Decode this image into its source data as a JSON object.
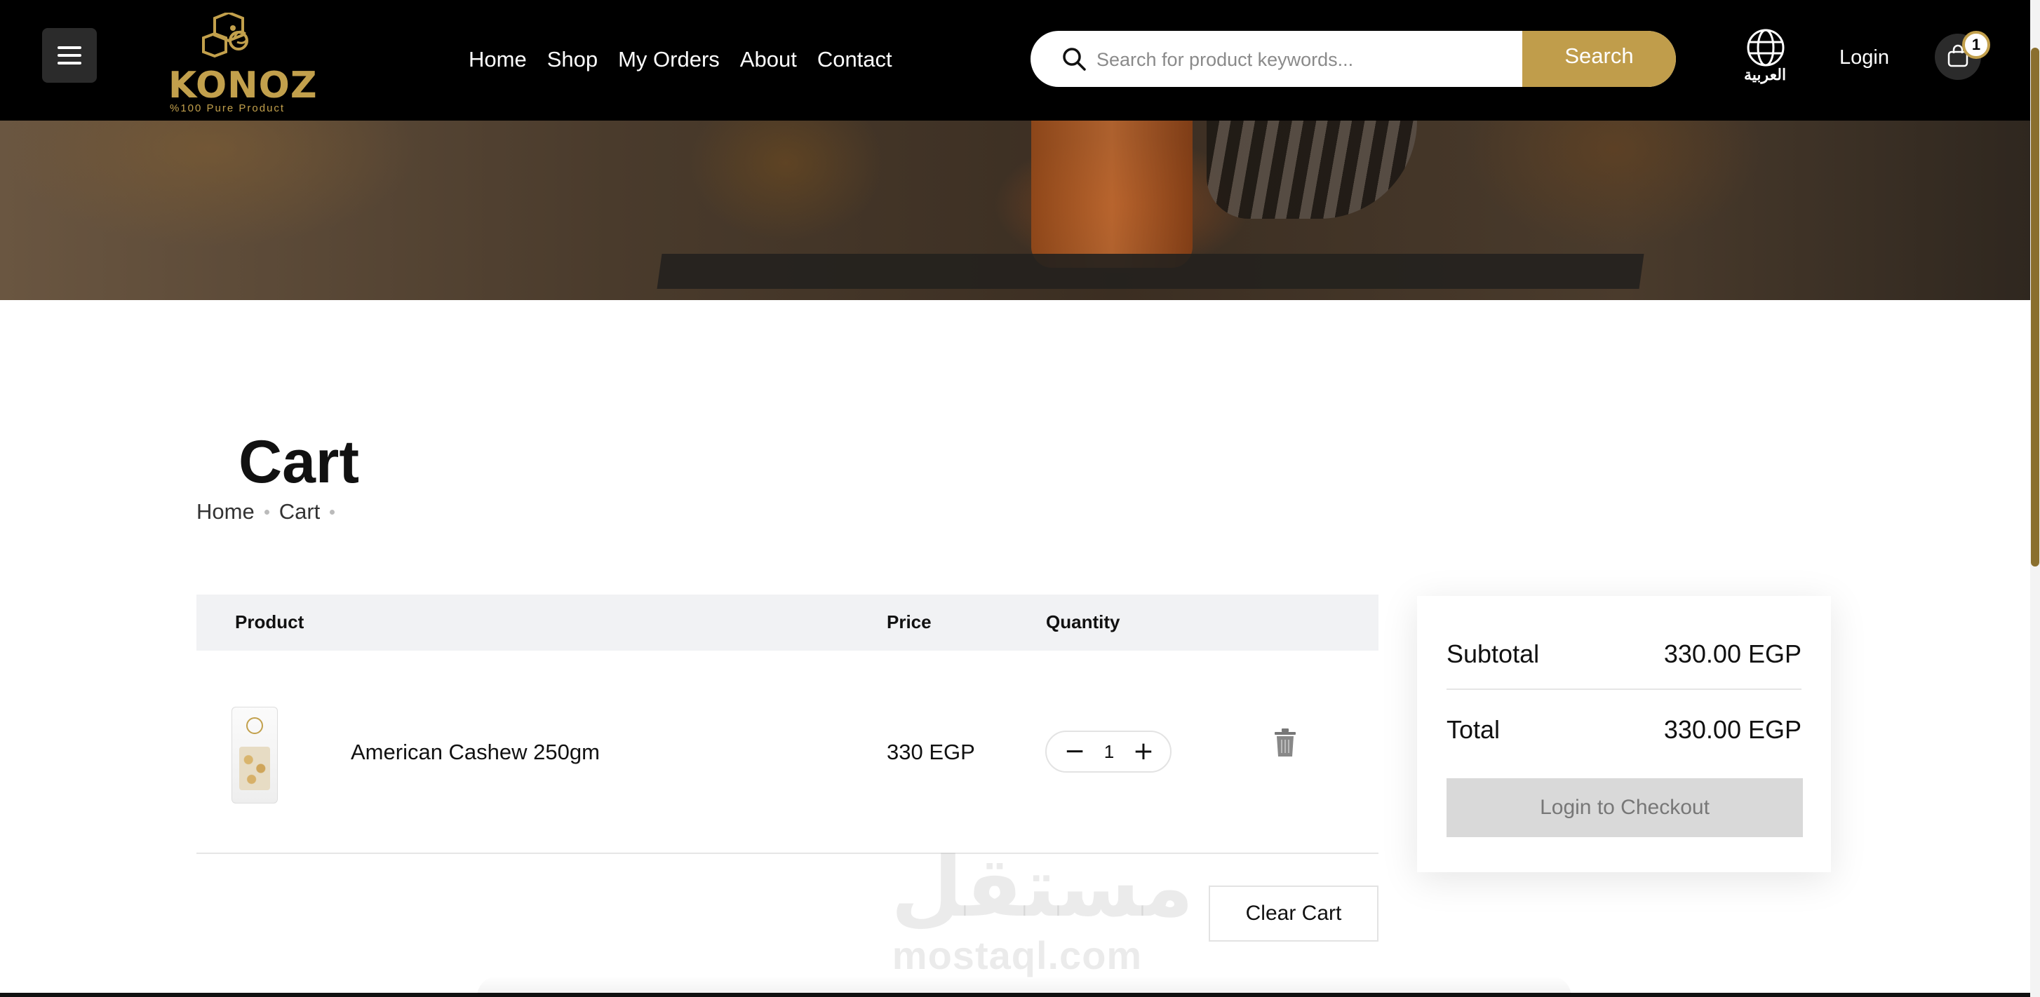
{
  "header": {
    "logo": {
      "word": "KONOZ",
      "tagline": "%100 Pure Product"
    },
    "nav": [
      "Home",
      "Shop",
      "My Orders",
      "About",
      "Contact"
    ],
    "search": {
      "placeholder": "Search for product keywords...",
      "button": "Search"
    },
    "language_label": "العربية",
    "login": "Login",
    "cart_count": "1",
    "icons": {
      "menu": "hamburger-icon",
      "search": "search-icon",
      "language": "globe-icon",
      "cart": "shopping-bag-icon"
    }
  },
  "page": {
    "title": "Cart",
    "breadcrumb": [
      "Home",
      "Cart"
    ]
  },
  "cart_table": {
    "headers": {
      "product": "Product",
      "price": "Price",
      "quantity": "Quantity"
    },
    "rows": [
      {
        "name": "American Cashew 250gm",
        "price": "330 EGP",
        "quantity": "1"
      }
    ],
    "clear_button": "Clear Cart",
    "qty_minus": "−",
    "qty_plus": "+"
  },
  "summary": {
    "subtotal_label": "Subtotal",
    "subtotal_value": "330.00 EGP",
    "total_label": "Total",
    "total_value": "330.00 EGP",
    "checkout_button": "Login to Checkout"
  },
  "watermark": {
    "arabic": "مستقل",
    "latin": "mostaql.com"
  },
  "colors": {
    "header_bg": "#000000",
    "accent_gold": "#c09d4b",
    "table_head_bg": "#f1f2f4",
    "disabled_btn": "#d9d9d9"
  }
}
